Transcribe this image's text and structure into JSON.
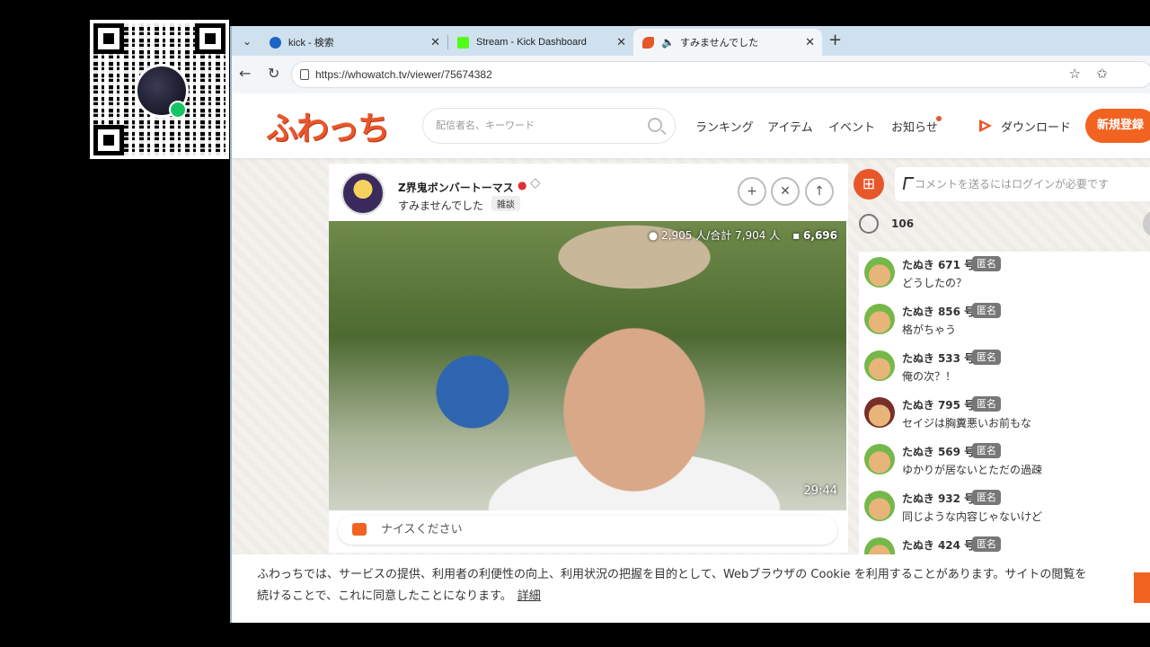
{
  "tabs": [
    {
      "label": "kick - 検索",
      "active": false
    },
    {
      "label": "Stream - Kick Dashboard",
      "active": false
    },
    {
      "label": "すみませんでした",
      "active": true
    }
  ],
  "browser": {
    "url": "https://whowatch.tv/viewer/75674382"
  },
  "site": {
    "logo_text": "ふわっち",
    "search_placeholder": "配信者名、キーワード",
    "nav": [
      "ランキング",
      "アイテム",
      "イベント",
      "お知らせ"
    ],
    "download_label": "ダウンロード",
    "signup_label": "新規登録",
    "accent_color": "#f26322"
  },
  "stream": {
    "streamer_name": "Z界鬼ボンバートーマス",
    "title": "すみませんでした",
    "tag": "雑談",
    "viewers": "2,905 人/合計 7,904 人",
    "comment_count": "6,696",
    "elapsed": "29:44",
    "comment_input_text": "ナイスください"
  },
  "chat": {
    "input_placeholder": "コメントを送るにはログインが必要です",
    "clap_count": "106",
    "anon_label": "匿名",
    "messages": [
      {
        "name": "たぬき 671 号",
        "text": "どうしたの？"
      },
      {
        "name": "たぬき 856 号",
        "text": "格がちゃう"
      },
      {
        "name": "たぬき 533 号",
        "text": "俺の次？！"
      },
      {
        "name": "たぬき 795 号",
        "text": "セイジは胸糞悪いお前もな"
      },
      {
        "name": "たぬき 569 号",
        "text": "ゆかりが居ないとただの過疎"
      },
      {
        "name": "たぬき 932 号",
        "text": "同じような内容じゃないけど"
      },
      {
        "name": "たぬき 424 号",
        "text": ""
      }
    ]
  },
  "cookie": {
    "line1": "ふわっちでは、サービスの提供、利用者の利便性の向上、利用状況の把握を目的として、Webブラウザの Cookie を利用することがあります。サイトの閲覧を",
    "line2": "続けることで、これに同意したことになります。",
    "link": "詳細"
  }
}
